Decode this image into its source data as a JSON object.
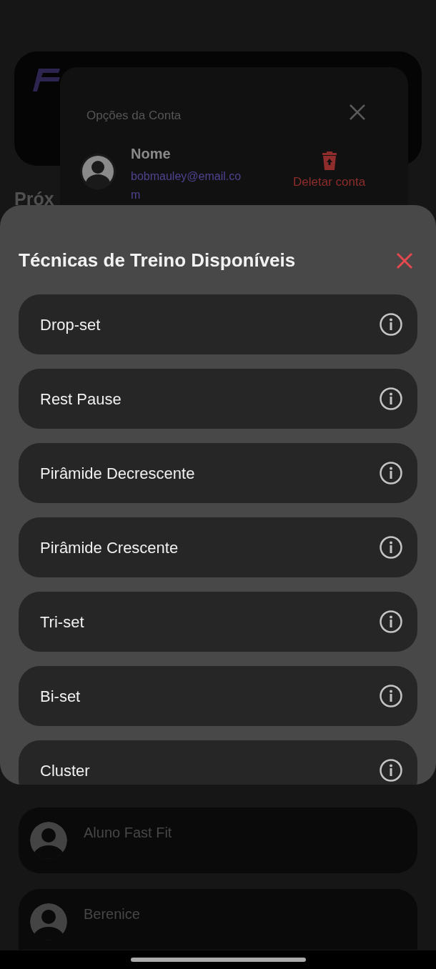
{
  "background": {
    "section_title": "Próx",
    "students": [
      {
        "name": "Aluno Fast Fit"
      },
      {
        "name": "Berenice"
      }
    ]
  },
  "account_dialog": {
    "title": "Opções da Conta",
    "user_name": "Nome",
    "email": "bobmauley@email.com",
    "delete_label": "Deletar conta"
  },
  "techniques_sheet": {
    "title": "Técnicas de Treino Disponíveis",
    "items": [
      {
        "label": "Drop-set"
      },
      {
        "label": "Rest Pause"
      },
      {
        "label": "Pirâmide Decrescente"
      },
      {
        "label": "Pirâmide Crescente"
      },
      {
        "label": "Tri-set"
      },
      {
        "label": "Bi-set"
      },
      {
        "label": "Cluster"
      }
    ]
  }
}
